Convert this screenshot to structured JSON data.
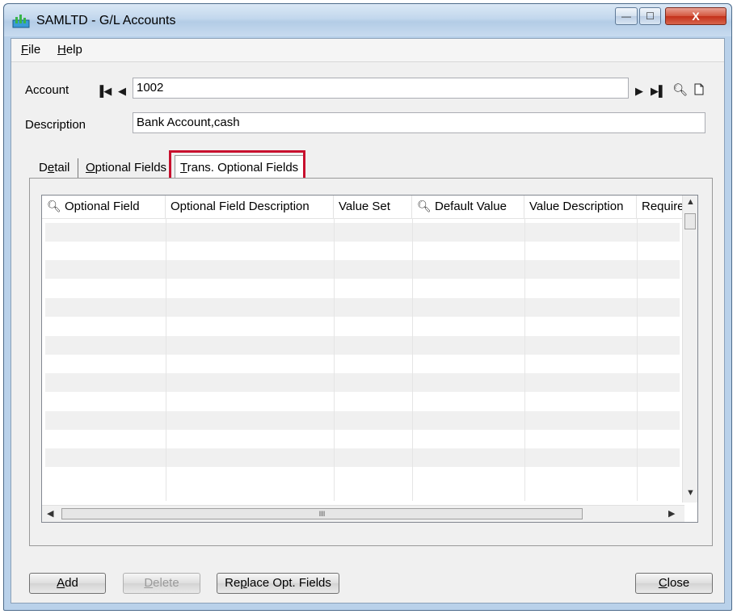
{
  "window": {
    "title": "SAMLTD - G/L Accounts",
    "minimize": "—",
    "maximize": "☐",
    "close": "X"
  },
  "menu": [
    {
      "label": "File",
      "accel": "F",
      "rest": "ile"
    },
    {
      "label": "Help",
      "accel": "H",
      "rest": "elp"
    }
  ],
  "form": {
    "account_label": "Account",
    "account_value": "1002",
    "description_label": "Description",
    "description_value": "Bank Account,cash"
  },
  "tabs": [
    {
      "label": "Detail",
      "pre": "D",
      "accel": "e",
      "post": "tail"
    },
    {
      "label": "Optional Fields",
      "pre": "",
      "accel": "O",
      "post": "ptional Fields"
    },
    {
      "label": "Trans. Optional Fields",
      "pre": "",
      "accel": "T",
      "post": "rans. Optional Fields",
      "active": true
    }
  ],
  "grid": {
    "columns": [
      {
        "label": "Optional Field",
        "finder": true
      },
      {
        "label": "Optional Field Description",
        "finder": false
      },
      {
        "label": "Value Set",
        "finder": false
      },
      {
        "label": "Default Value",
        "finder": true
      },
      {
        "label": "Value Description",
        "finder": false
      },
      {
        "label": "Require",
        "finder": false
      }
    ],
    "hscroll_grip": "III"
  },
  "buttons": {
    "add": {
      "label": "Add",
      "accel": "A",
      "rest": "dd"
    },
    "delete": {
      "label": "Delete",
      "accel": "D",
      "rest": "elete"
    },
    "replace": {
      "label": "Replace Opt. Fields",
      "pre": "Re",
      "accel": "p",
      "post": "lace Opt. Fields"
    },
    "close": {
      "label": "Close",
      "accel": "C",
      "rest": "lose"
    }
  },
  "colors": {
    "highlight": "#c8102e",
    "titlebar": "#c2d7ed"
  }
}
